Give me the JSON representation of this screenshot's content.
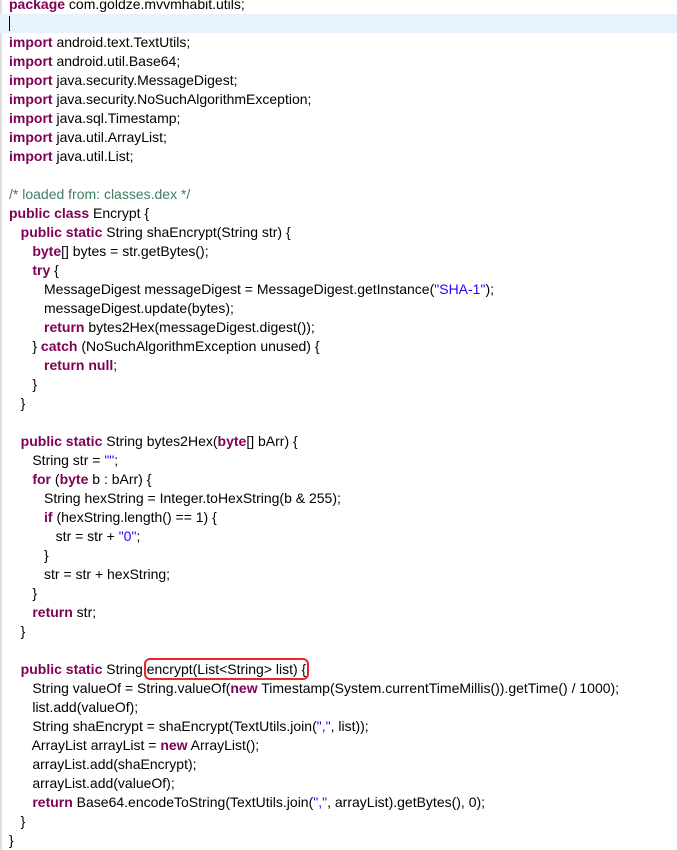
{
  "editor": {
    "lines": [
      [
        {
          "t": "package",
          "c": "kw"
        },
        {
          "t": " com.goldze.mvvmhabit.utils;"
        }
      ],
      [],
      [
        {
          "t": "import",
          "c": "kw"
        },
        {
          "t": " android.text.TextUtils;"
        }
      ],
      [
        {
          "t": "import",
          "c": "kw"
        },
        {
          "t": " android.util.Base64;"
        }
      ],
      [
        {
          "t": "import",
          "c": "kw"
        },
        {
          "t": " java.security.MessageDigest;"
        }
      ],
      [
        {
          "t": "import",
          "c": "kw"
        },
        {
          "t": " java.security.NoSuchAlgorithmException;"
        }
      ],
      [
        {
          "t": "import",
          "c": "kw"
        },
        {
          "t": " java.sql.Timestamp;"
        }
      ],
      [
        {
          "t": "import",
          "c": "kw"
        },
        {
          "t": " java.util.ArrayList;"
        }
      ],
      [
        {
          "t": "import",
          "c": "kw"
        },
        {
          "t": " java.util.List;"
        }
      ],
      [],
      [
        {
          "t": "/* loaded from: classes.dex */",
          "c": "cmt"
        }
      ],
      [
        {
          "t": "public class",
          "c": "kw"
        },
        {
          "t": " Encrypt {"
        }
      ],
      [
        {
          "t": "   "
        },
        {
          "t": "public static",
          "c": "kw"
        },
        {
          "t": " String shaEncrypt(String str) {"
        }
      ],
      [
        {
          "t": "      "
        },
        {
          "t": "byte",
          "c": "kw"
        },
        {
          "t": "[] bytes = str.getBytes();"
        }
      ],
      [
        {
          "t": "      "
        },
        {
          "t": "try",
          "c": "kw"
        },
        {
          "t": " {"
        }
      ],
      [
        {
          "t": "         MessageDigest messageDigest = MessageDigest.getInstance("
        },
        {
          "t": "\"SHA-1\"",
          "c": "str"
        },
        {
          "t": ");"
        }
      ],
      [
        {
          "t": "         messageDigest.update(bytes);"
        }
      ],
      [
        {
          "t": "         "
        },
        {
          "t": "return",
          "c": "kw"
        },
        {
          "t": " bytes2Hex(messageDigest.digest());"
        }
      ],
      [
        {
          "t": "      } "
        },
        {
          "t": "catch",
          "c": "kw"
        },
        {
          "t": " (NoSuchAlgorithmException unused) {"
        }
      ],
      [
        {
          "t": "         "
        },
        {
          "t": "return null",
          "c": "kw"
        },
        {
          "t": ";"
        }
      ],
      [
        {
          "t": "      }"
        }
      ],
      [
        {
          "t": "   }"
        }
      ],
      [],
      [
        {
          "t": "   "
        },
        {
          "t": "public static",
          "c": "kw"
        },
        {
          "t": " String bytes2Hex("
        },
        {
          "t": "byte",
          "c": "kw"
        },
        {
          "t": "[] bArr) {"
        }
      ],
      [
        {
          "t": "      String str = "
        },
        {
          "t": "\"\"",
          "c": "str"
        },
        {
          "t": ";"
        }
      ],
      [
        {
          "t": "      "
        },
        {
          "t": "for",
          "c": "kw"
        },
        {
          "t": " ("
        },
        {
          "t": "byte",
          "c": "kw"
        },
        {
          "t": " b : bArr) {"
        }
      ],
      [
        {
          "t": "         String hexString = Integer.toHexString(b & 255);"
        }
      ],
      [
        {
          "t": "         "
        },
        {
          "t": "if",
          "c": "kw"
        },
        {
          "t": " (hexString.length() == 1) {"
        }
      ],
      [
        {
          "t": "            str = str + "
        },
        {
          "t": "\"0\"",
          "c": "str"
        },
        {
          "t": ";"
        }
      ],
      [
        {
          "t": "         }"
        }
      ],
      [
        {
          "t": "         str = str + hexString;"
        }
      ],
      [
        {
          "t": "      }"
        }
      ],
      [
        {
          "t": "      "
        },
        {
          "t": "return",
          "c": "kw"
        },
        {
          "t": " str;"
        }
      ],
      [
        {
          "t": "   }"
        }
      ],
      [],
      [
        {
          "t": "   "
        },
        {
          "t": "public static",
          "c": "kw"
        },
        {
          "t": " String "
        },
        {
          "t": "encrypt(List<String> list) {",
          "c": "hl"
        }
      ],
      [
        {
          "t": "      String valueOf = String.valueOf("
        },
        {
          "t": "new",
          "c": "kw"
        },
        {
          "t": " Timestamp(System.currentTimeMillis()).getTime() / 1000);"
        }
      ],
      [
        {
          "t": "      list.add(valueOf);"
        }
      ],
      [
        {
          "t": "      String shaEncrypt = shaEncrypt(TextUtils.join("
        },
        {
          "t": "\",\"",
          "c": "str"
        },
        {
          "t": ", list));"
        }
      ],
      [
        {
          "t": "      ArrayList arrayList = "
        },
        {
          "t": "new",
          "c": "kw"
        },
        {
          "t": " ArrayList();"
        }
      ],
      [
        {
          "t": "      arrayList.add(shaEncrypt);"
        }
      ],
      [
        {
          "t": "      arrayList.add(valueOf);"
        }
      ],
      [
        {
          "t": "      "
        },
        {
          "t": "return",
          "c": "kw"
        },
        {
          "t": " Base64.encodeToString(TextUtils.join("
        },
        {
          "t": "\",\"",
          "c": "str"
        },
        {
          "t": ", arrayList).getBytes(), 0);"
        }
      ],
      [
        {
          "t": "   }"
        }
      ],
      [
        {
          "t": "}"
        }
      ]
    ],
    "current_line": 1,
    "colors": {
      "keyword": "#7f0055",
      "string": "#2a00ff",
      "comment": "#3f7f5f",
      "highlight_box": "#e8262a",
      "current_line": "#e8f2fe"
    }
  }
}
